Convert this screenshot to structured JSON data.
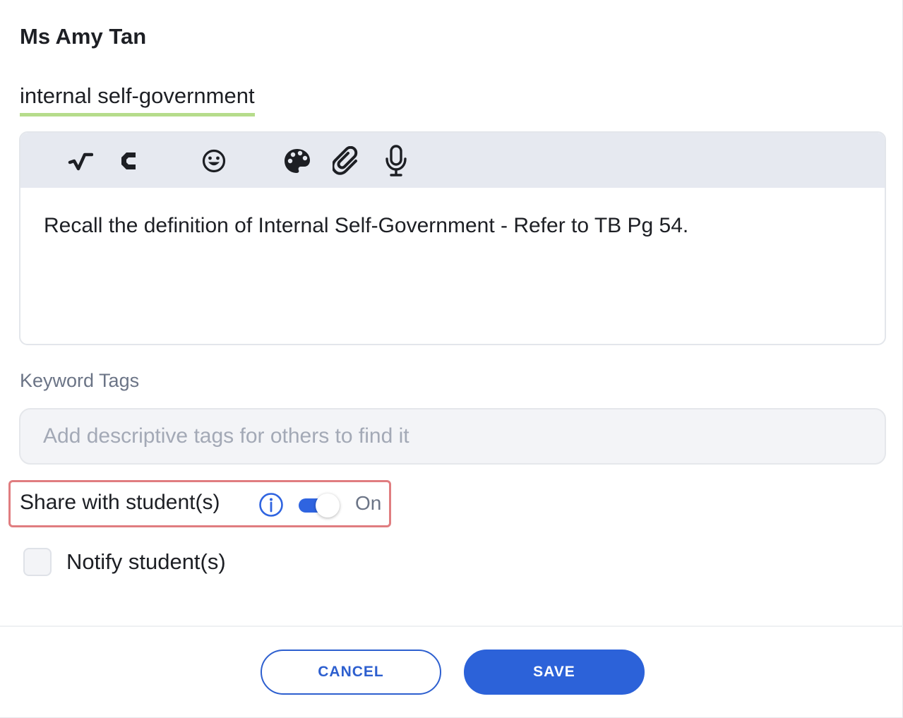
{
  "author": {
    "name": "Ms Amy Tan"
  },
  "highlight": {
    "text": "internal self-government",
    "underline_color": "#b6dc8b"
  },
  "editor": {
    "toolbar": [
      {
        "name": "sqrt-icon",
        "label": "Math equation"
      },
      {
        "name": "chemistry-icon",
        "label": "Chemistry"
      },
      {
        "name": "emoji-icon",
        "label": "Emoji"
      },
      {
        "name": "palette-icon",
        "label": "Color"
      },
      {
        "name": "paperclip-icon",
        "label": "Attachment"
      },
      {
        "name": "microphone-icon",
        "label": "Voice recording"
      }
    ],
    "content": "Recall the definition of Internal Self-Government - Refer to TB Pg 54."
  },
  "tags": {
    "label": "Keyword Tags",
    "placeholder": "Add descriptive tags for others to find it",
    "value": ""
  },
  "share": {
    "label": "Share with student(s)",
    "enabled": true,
    "state_text": "On",
    "accent_color": "#2f64e0",
    "highlight_border_color": "#e07d80"
  },
  "notify": {
    "label": "Notify student(s)",
    "checked": false
  },
  "actions": {
    "cancel_label": "CANCEL",
    "save_label": "SAVE",
    "primary_color": "#2c62d9"
  }
}
